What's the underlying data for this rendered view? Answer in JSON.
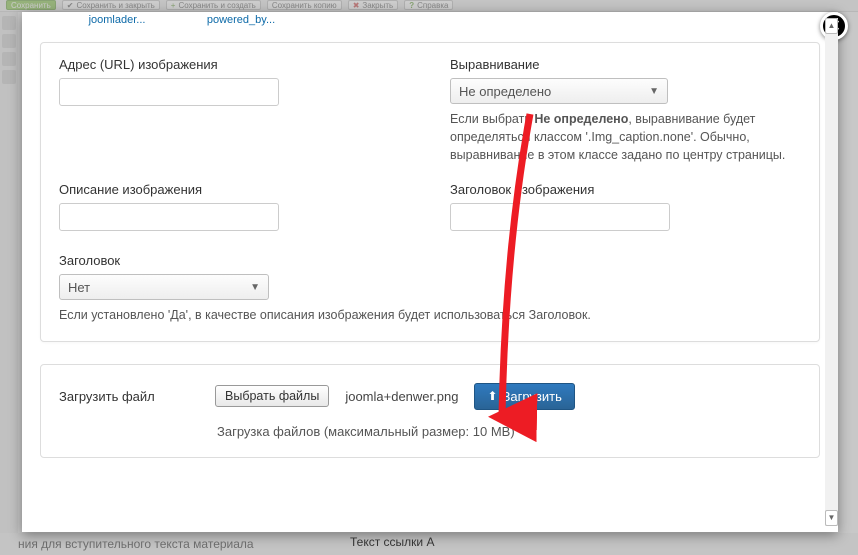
{
  "bg_toolbar": {
    "save": "Сохранить",
    "save_close": "Сохранить и закрыть",
    "save_new": "Сохранить и создать",
    "save_copy": "Сохранить копию",
    "close": "Закрыть",
    "help": "Справка"
  },
  "bg_bottom": {
    "left": "ния для вступительного текста материала",
    "right": "Текст ссылки A"
  },
  "thumbs": [
    "joomlader...",
    "powered_by..."
  ],
  "form": {
    "url_label": "Адрес (URL) изображения",
    "align_label": "Выравнивание",
    "align_value": "Не определено",
    "align_help_pre": "Если выбрать ",
    "align_help_bold": "Не определено",
    "align_help_post": ", выравнивание будет определяться классом '.Img_caption.none'. Обычно, выравнивание в этом классе задано по центру страницы.",
    "desc_label": "Описание изображения",
    "title_label": "Заголовок изображения",
    "heading_label": "Заголовок",
    "heading_value": "Нет",
    "heading_help": "Если установлено 'Да', в качестве описания изображения будет использоваться Заголовок."
  },
  "upload": {
    "label": "Загрузить файл",
    "choose_button": "Выбрать файлы",
    "file_name": "joomla+denwer.png",
    "upload_button": "Загрузить",
    "hint": "Загрузка файлов (максимальный размер: 10 MB)"
  },
  "colors": {
    "primary": "#2a6cb0",
    "arrow": "#ed1c24"
  }
}
